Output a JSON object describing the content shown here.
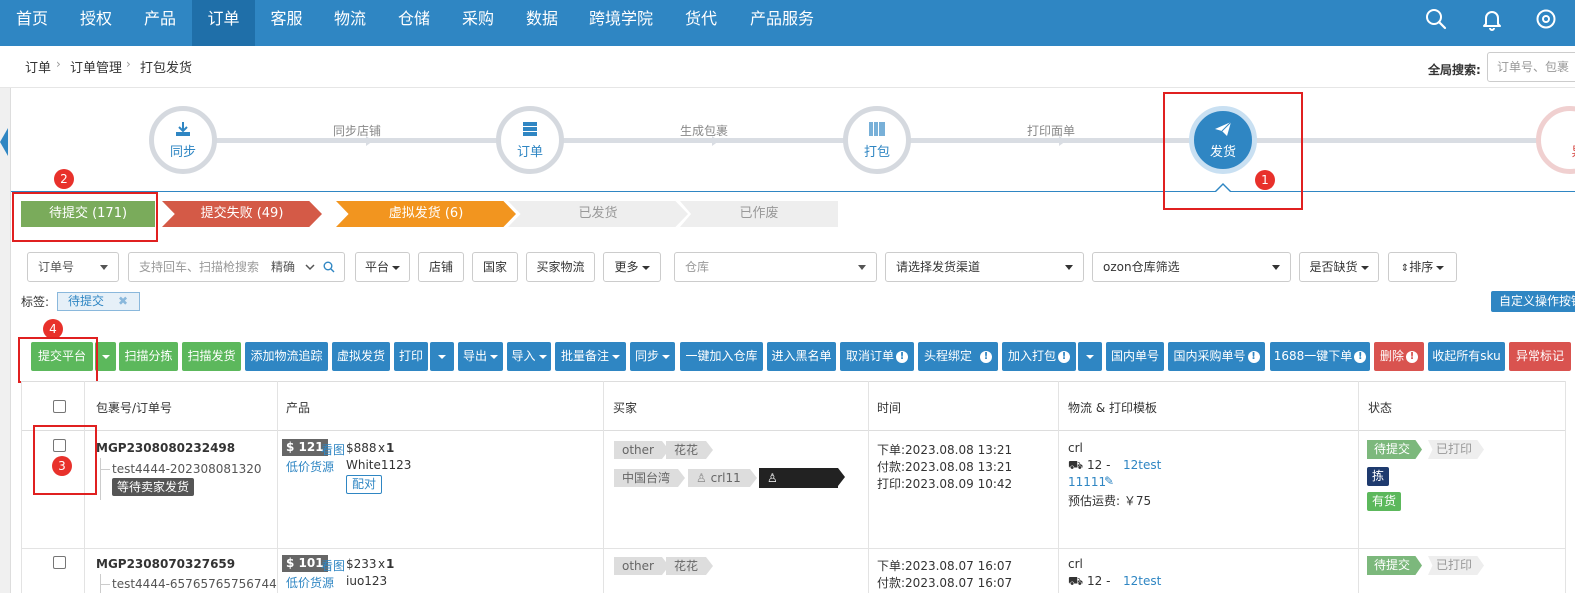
{
  "nav": {
    "items": [
      "首页",
      "授权",
      "产品",
      "订单",
      "客服",
      "物流",
      "仓储",
      "采购",
      "数据",
      "跨境学院",
      "货代",
      "产品服务"
    ],
    "active_index": 3
  },
  "breadcrumb": [
    "订单",
    "订单管理",
    "打包发货"
  ],
  "global_search": {
    "label": "全局搜索:",
    "placeholder": "订单号、包裹"
  },
  "steps": {
    "items": [
      "同步",
      "订单",
      "打包",
      "发货"
    ],
    "partial_next": "异",
    "connectors": [
      "同步店铺",
      "生成包裹",
      "打印面单"
    ],
    "active_index": 3
  },
  "badges": {
    "b1": "1",
    "b2": "2",
    "b3": "3",
    "b4": "4"
  },
  "status_tabs": [
    {
      "label": "待提交 (171)",
      "color": "#7aab5b"
    },
    {
      "label": "提交失败 (49)",
      "color": "#d45a47"
    },
    {
      "label": "虚拟发货 (6)",
      "color": "#f2951f"
    },
    {
      "label": "已发货",
      "color": "#eeeeee"
    },
    {
      "label": "已作废",
      "color": "#eeeeee"
    }
  ],
  "filters": {
    "order_no": "订单号",
    "search_placeholder": "支持回车、扫描枪搜索",
    "search_mode": "精确",
    "platform": "平台",
    "store": "店铺",
    "country": "国家",
    "buyer_logistics": "买家物流",
    "more": "更多",
    "warehouse": "仓库",
    "channel": "请选择发货渠道",
    "ozon": "ozon仓库筛选",
    "out_of_stock": "是否缺货",
    "sort": "排序"
  },
  "tags": {
    "label": "标签:",
    "chip": "待提交",
    "custom_btn": "自定义操作按钮"
  },
  "toolbar": {
    "submit": "提交平台",
    "scan_sort": "扫描分拣",
    "scan_ship": "扫描发货",
    "add_track": "添加物流追踪",
    "virtual_ship": "虚拟发货",
    "print": "打印",
    "export": "导出",
    "import": "导入",
    "batch_note": "批量备注",
    "sync": "同步",
    "add_warehouse": "一键加入仓库",
    "blacklist": "进入黑名单",
    "cancel_order": "取消订单",
    "head_bind": "头程绑定",
    "add_pack": "加入打包",
    "domestic_no": "国内单号",
    "domestic_purchase": "国内采购单号",
    "order_1688": "1688一键下单",
    "delete": "删除",
    "collapse_sku": "收起所有sku",
    "exception_mark": "异常标记"
  },
  "table": {
    "headers": [
      "包裹号/订单号",
      "产品",
      "买家",
      "时间",
      "物流 & 打印模板",
      "状态"
    ],
    "rows": [
      {
        "package_no": "MGP2308080232498",
        "order_no": "test4444-202308081320",
        "wait_tag": "等待卖家发货",
        "price": "$ 121",
        "view_img": "看图",
        "low_price": "低价货源",
        "sku_price": "$888",
        "qty_x": "x",
        "qty": "1",
        "sku": "White1123",
        "match": "配对",
        "buyer_tags": [
          "other",
          "花花"
        ],
        "region": "中国台湾",
        "buyer_name": "crl11",
        "buyer_black": "crl11(黑)",
        "order_time": "下单:2023.08.08 13:21",
        "pay_time": "付款:2023.08.08 13:21",
        "print_time": "打印:2023.08.09 10:42",
        "logistics": "crl",
        "channel": "12 - ",
        "channel_link": "12test",
        "template": "11111",
        "fee": "预估运费: ￥75",
        "status": "待提交",
        "printed": "已打印",
        "pick": "拣",
        "stock": "有货"
      },
      {
        "package_no": "MGP2308070327659",
        "order_no": "test4444-65765765756744",
        "price": "$ 101",
        "view_img": "看图",
        "low_price": "低价货源",
        "sku_price": "$233",
        "qty_x": "x",
        "qty": "1",
        "sku": "iuo123",
        "buyer_tags": [
          "other",
          "花花"
        ],
        "order_time": "下单:2023.08.07 16:07",
        "pay_time": "付款:2023.08.07 16:07",
        "logistics": "crl",
        "channel": "12 - ",
        "channel_link": "12test",
        "status": "待提交",
        "printed": "已打印"
      }
    ]
  }
}
